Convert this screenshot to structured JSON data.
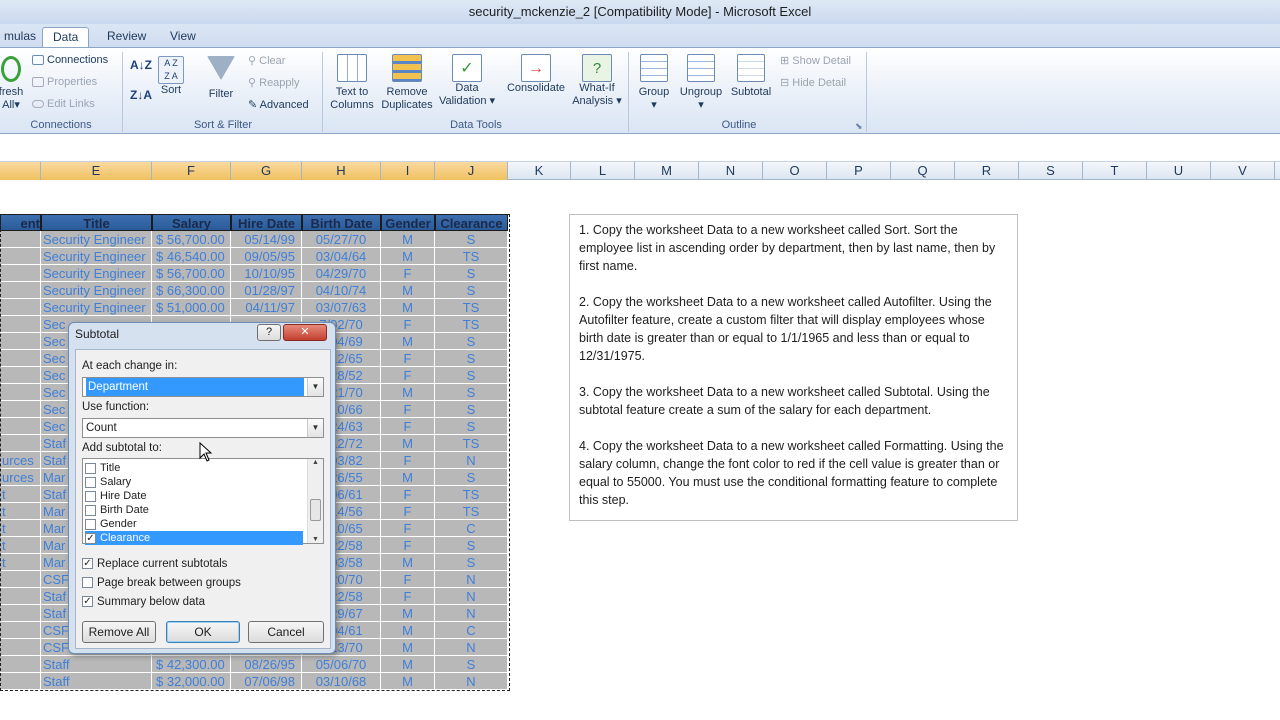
{
  "window": {
    "title": "security_mckenzie_2  [Compatibility Mode]  -  Microsoft Excel"
  },
  "tabs": [
    "mulas",
    "Data",
    "Review",
    "View"
  ],
  "ribbon": {
    "connections": {
      "refresh_top": "fresh",
      "refresh_bottom": "All",
      "connections": "Connections",
      "properties": "Properties",
      "edit_links": "Edit Links",
      "label": "Connections"
    },
    "sort_filter": {
      "sort": "Sort",
      "filter": "Filter",
      "clear": "Clear",
      "reapply": "Reapply",
      "advanced": "Advanced",
      "label": "Sort & Filter"
    },
    "data_tools": {
      "text_to_columns_1": "Text to",
      "text_to_columns_2": "Columns",
      "remove_duplicates_1": "Remove",
      "remove_duplicates_2": "Duplicates",
      "data_validation_1": "Data",
      "data_validation_2": "Validation",
      "consolidate": "Consolidate",
      "what_if_1": "What-If",
      "what_if_2": "Analysis",
      "label": "Data Tools"
    },
    "outline": {
      "group": "Group",
      "ungroup": "Ungroup",
      "subtotal": "Subtotal",
      "show_detail": "Show Detail",
      "hide_detail": "Hide Detail",
      "label": "Outline"
    }
  },
  "columns": [
    "E",
    "F",
    "G",
    "H",
    "I",
    "J",
    "K",
    "L",
    "M",
    "N",
    "O",
    "P",
    "Q",
    "R",
    "S",
    "T",
    "U",
    "V"
  ],
  "table": {
    "headers": [
      "ent",
      "Title",
      "Salary",
      "Hire Date",
      "Birth Date",
      "Gender",
      "Clearance"
    ],
    "rows": [
      [
        "",
        "Security Engineer",
        "$ 56,700.00",
        "05/14/99",
        "05/27/70",
        "M",
        "S"
      ],
      [
        "",
        "Security Engineer",
        "$ 46,540.00",
        "09/05/95",
        "03/04/64",
        "M",
        "TS"
      ],
      [
        "",
        "Security Engineer",
        "$ 56,700.00",
        "10/10/95",
        "04/29/70",
        "F",
        "S"
      ],
      [
        "",
        "Security Engineer",
        "$ 66,300.00",
        "01/28/97",
        "04/10/74",
        "M",
        "S"
      ],
      [
        "",
        "Security Engineer",
        "$ 51,000.00",
        "04/11/97",
        "03/07/63",
        "M",
        "TS"
      ],
      [
        "",
        "Sec",
        "",
        "",
        "7/02/70",
        "F",
        "TS"
      ],
      [
        "",
        "Sec",
        "",
        "",
        "2/04/69",
        "M",
        "S"
      ],
      [
        "",
        "Sec",
        "",
        "",
        "2/12/65",
        "F",
        "S"
      ],
      [
        "",
        "Sec",
        "",
        "",
        "3/28/52",
        "F",
        "S"
      ],
      [
        "",
        "Sec",
        "",
        "",
        "3/21/70",
        "M",
        "S"
      ],
      [
        "",
        "Sec",
        "",
        "",
        "3/10/66",
        "F",
        "S"
      ],
      [
        "",
        "Sec",
        "",
        "",
        "1/24/63",
        "F",
        "S"
      ],
      [
        "",
        "Staf",
        "",
        "",
        "2/12/72",
        "M",
        "TS"
      ],
      [
        "urces",
        "Staf",
        "",
        "",
        "5/03/82",
        "F",
        "N"
      ],
      [
        "urces",
        "Mar",
        "",
        "",
        "4/26/55",
        "M",
        "S"
      ],
      [
        "t",
        "Staf",
        "",
        "",
        "5/06/61",
        "F",
        "TS"
      ],
      [
        "t",
        "Mar",
        "",
        "",
        "2/14/56",
        "F",
        "TS"
      ],
      [
        "t",
        "Mar",
        "",
        "",
        "4/10/65",
        "F",
        "C"
      ],
      [
        "t",
        "Mar",
        "",
        "",
        "2/22/58",
        "F",
        "S"
      ],
      [
        "t",
        "Mar",
        "",
        "",
        "2/03/58",
        "M",
        "S"
      ],
      [
        "",
        "CSF",
        "",
        "",
        "3/20/70",
        "F",
        "N"
      ],
      [
        "",
        "Staf",
        "",
        "",
        "3/22/58",
        "F",
        "N"
      ],
      [
        "",
        "Staf",
        "",
        "",
        "4/29/67",
        "M",
        "N"
      ],
      [
        "",
        "CSF",
        "",
        "",
        "5/04/61",
        "M",
        "C"
      ],
      [
        "",
        "CSF",
        "",
        "",
        "7/13/70",
        "M",
        "N"
      ],
      [
        "",
        "Staff",
        "$ 42,300.00",
        "08/26/95",
        "05/06/70",
        "M",
        "S"
      ],
      [
        "",
        "Staff",
        "$ 32,000.00",
        "07/06/98",
        "03/10/68",
        "M",
        "N"
      ]
    ]
  },
  "notes": [
    "1. Copy the worksheet Data to a  new worksheet called Sort. Sort the employee list in ascending order by department, then by last name, then by first name.",
    "2. Copy the worksheet Data to a  new worksheet called Autofilter. Using the Autofilter feature, create a custom filter that will display employees whose birth date is greater than or equal to 1/1/1965  and less than or equal to 12/31/1975.",
    "3. Copy the worksheet Data to a  new worksheet called Subtotal. Using the subtotal feature create a sum of the salary for each department.",
    "4. Copy the worksheet Data to a  new worksheet called Formatting. Using the salary column, change the font color to red if the cell value is greater than or equal to 55000.  You must use the conditional formatting feature to complete this step."
  ],
  "dialog": {
    "title": "Subtotal",
    "help": "?",
    "close": "✕",
    "at_each_change_label": "At each change in:",
    "at_each_change_value": "Department",
    "use_function_label": "Use function:",
    "use_function_value": "Count",
    "add_subtotal_label": "Add subtotal to:",
    "list": [
      {
        "label": "Title",
        "checked": false
      },
      {
        "label": "Salary",
        "checked": false
      },
      {
        "label": "Hire Date",
        "checked": false
      },
      {
        "label": "Birth Date",
        "checked": false
      },
      {
        "label": "Gender",
        "checked": false
      },
      {
        "label": "Clearance",
        "checked": true
      }
    ],
    "replace_current": "Replace current subtotals",
    "page_break": "Page break between groups",
    "summary_below": "Summary below data",
    "remove_all": "Remove All",
    "ok": "OK",
    "cancel": "Cancel"
  },
  "icons": [
    "refresh-icon",
    "connections-icon",
    "properties-icon",
    "edit-links-icon",
    "sort-asc-icon",
    "sort-desc-icon",
    "sort-icon",
    "filter-icon",
    "clear-icon",
    "reapply-icon",
    "advanced-icon",
    "text-to-columns-icon",
    "remove-duplicates-icon",
    "data-validation-icon",
    "consolidate-icon",
    "what-if-icon",
    "group-icon",
    "ungroup-icon",
    "subtotal-icon",
    "show-detail-icon",
    "hide-detail-icon",
    "mouse-cursor-icon"
  ]
}
